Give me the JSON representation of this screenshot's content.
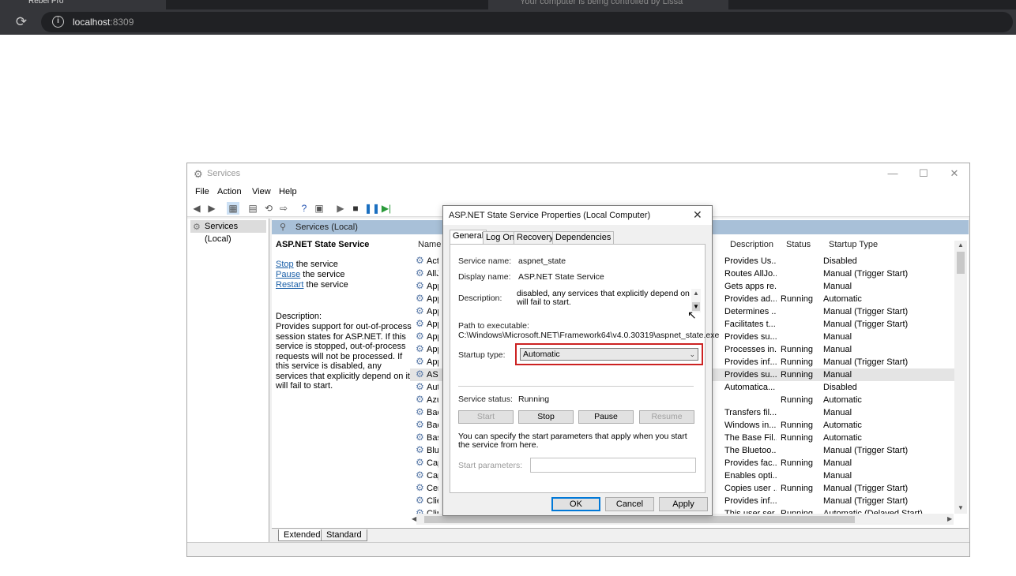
{
  "browser": {
    "tab_title": "Rebel Pro",
    "banner": "Your computer is being controlled by Lissa",
    "url_host": "localhost",
    "url_port": ":8309"
  },
  "window": {
    "title": "Services",
    "menu": [
      "File",
      "Action",
      "View",
      "Help"
    ],
    "tree_item": "Services (Local)",
    "pane_header": "Services (Local)"
  },
  "extended": {
    "service_name": "ASP.NET State Service",
    "actions": [
      {
        "link": "Stop",
        "rest": " the service"
      },
      {
        "link": "Pause",
        "rest": " the service"
      },
      {
        "link": "Restart",
        "rest": " the service"
      }
    ],
    "description_label": "Description:",
    "description": "Provides support for out-of-process session states for ASP.NET. If this service is stopped, out-of-process requests will not be processed. If this service is disabled, any services that explicitly depend on it will fail to start."
  },
  "list": {
    "columns": {
      "name": "Name",
      "description": "Description",
      "status": "Status",
      "startup": "Startup Type"
    },
    "rows": [
      {
        "name": "Acti",
        "desc": "Provides Us...",
        "status": "",
        "startup": "Disabled"
      },
      {
        "name": "AllJo",
        "desc": "Routes AllJo...",
        "status": "",
        "startup": "Manual (Trigger Start)"
      },
      {
        "name": "App",
        "desc": "Gets apps re...",
        "status": "",
        "startup": "Manual"
      },
      {
        "name": "App",
        "desc": "Provides ad...",
        "status": "Running",
        "startup": "Automatic"
      },
      {
        "name": "App",
        "desc": "Determines ...",
        "status": "",
        "startup": "Manual (Trigger Start)"
      },
      {
        "name": "App",
        "desc": "Facilitates t...",
        "status": "",
        "startup": "Manual (Trigger Start)"
      },
      {
        "name": "App",
        "desc": "Provides su...",
        "status": "",
        "startup": "Manual"
      },
      {
        "name": "App",
        "desc": "Processes in...",
        "status": "Running",
        "startup": "Manual"
      },
      {
        "name": "App",
        "desc": "Provides inf...",
        "status": "Running",
        "startup": "Manual (Trigger Start)"
      },
      {
        "name": "ASP.",
        "desc": "Provides su...",
        "status": "Running",
        "startup": "Manual"
      },
      {
        "name": "Auto",
        "desc": "Automatica...",
        "status": "",
        "startup": "Disabled"
      },
      {
        "name": "Azur",
        "desc": "",
        "status": "Running",
        "startup": "Automatic"
      },
      {
        "name": "Back",
        "desc": "Transfers fil...",
        "status": "",
        "startup": "Manual"
      },
      {
        "name": "Back",
        "desc": "Windows in...",
        "status": "Running",
        "startup": "Automatic"
      },
      {
        "name": "Base",
        "desc": "The Base Fil...",
        "status": "Running",
        "startup": "Automatic"
      },
      {
        "name": "Blue",
        "desc": "The Bluetoo...",
        "status": "",
        "startup": "Manual (Trigger Start)"
      },
      {
        "name": "Capa",
        "desc": "Provides fac...",
        "status": "Running",
        "startup": "Manual"
      },
      {
        "name": "Capt",
        "desc": "Enables opti...",
        "status": "",
        "startup": "Manual"
      },
      {
        "name": "Cert",
        "desc": "Copies user ...",
        "status": "Running",
        "startup": "Manual (Trigger Start)"
      },
      {
        "name": "Clien",
        "desc": "Provides inf...",
        "status": "",
        "startup": "Manual (Trigger Start)"
      },
      {
        "name": "Clip",
        "desc": "This user ser...",
        "status": "Running",
        "startup": "Automatic (Delayed Start)"
      }
    ],
    "bottom_tabs": [
      "Extended",
      "Standard"
    ]
  },
  "dialog": {
    "title": "ASP.NET State Service Properties (Local Computer)",
    "tabs": [
      "General",
      "Log On",
      "Recovery",
      "Dependencies"
    ],
    "service_name_label": "Service name:",
    "service_name": "aspnet_state",
    "display_name_label": "Display name:",
    "display_name": "ASP.NET State Service",
    "description_label": "Description:",
    "description": "disabled, any services that explicitly depend on it will fail to start.",
    "path_label": "Path to executable:",
    "path": "C:\\Windows\\Microsoft.NET\\Framework64\\v4.0.30319\\aspnet_state.exe",
    "startup_type_label": "Startup type:",
    "startup_type": "Automatic",
    "service_status_label": "Service status:",
    "service_status": "Running",
    "buttons": {
      "start": "Start",
      "stop": "Stop",
      "pause": "Pause",
      "resume": "Resume"
    },
    "param_note": "You can specify the start parameters that apply when you start the service from here.",
    "param_label": "Start parameters:",
    "param_value": "",
    "ok": "OK",
    "cancel": "Cancel",
    "apply": "Apply"
  }
}
